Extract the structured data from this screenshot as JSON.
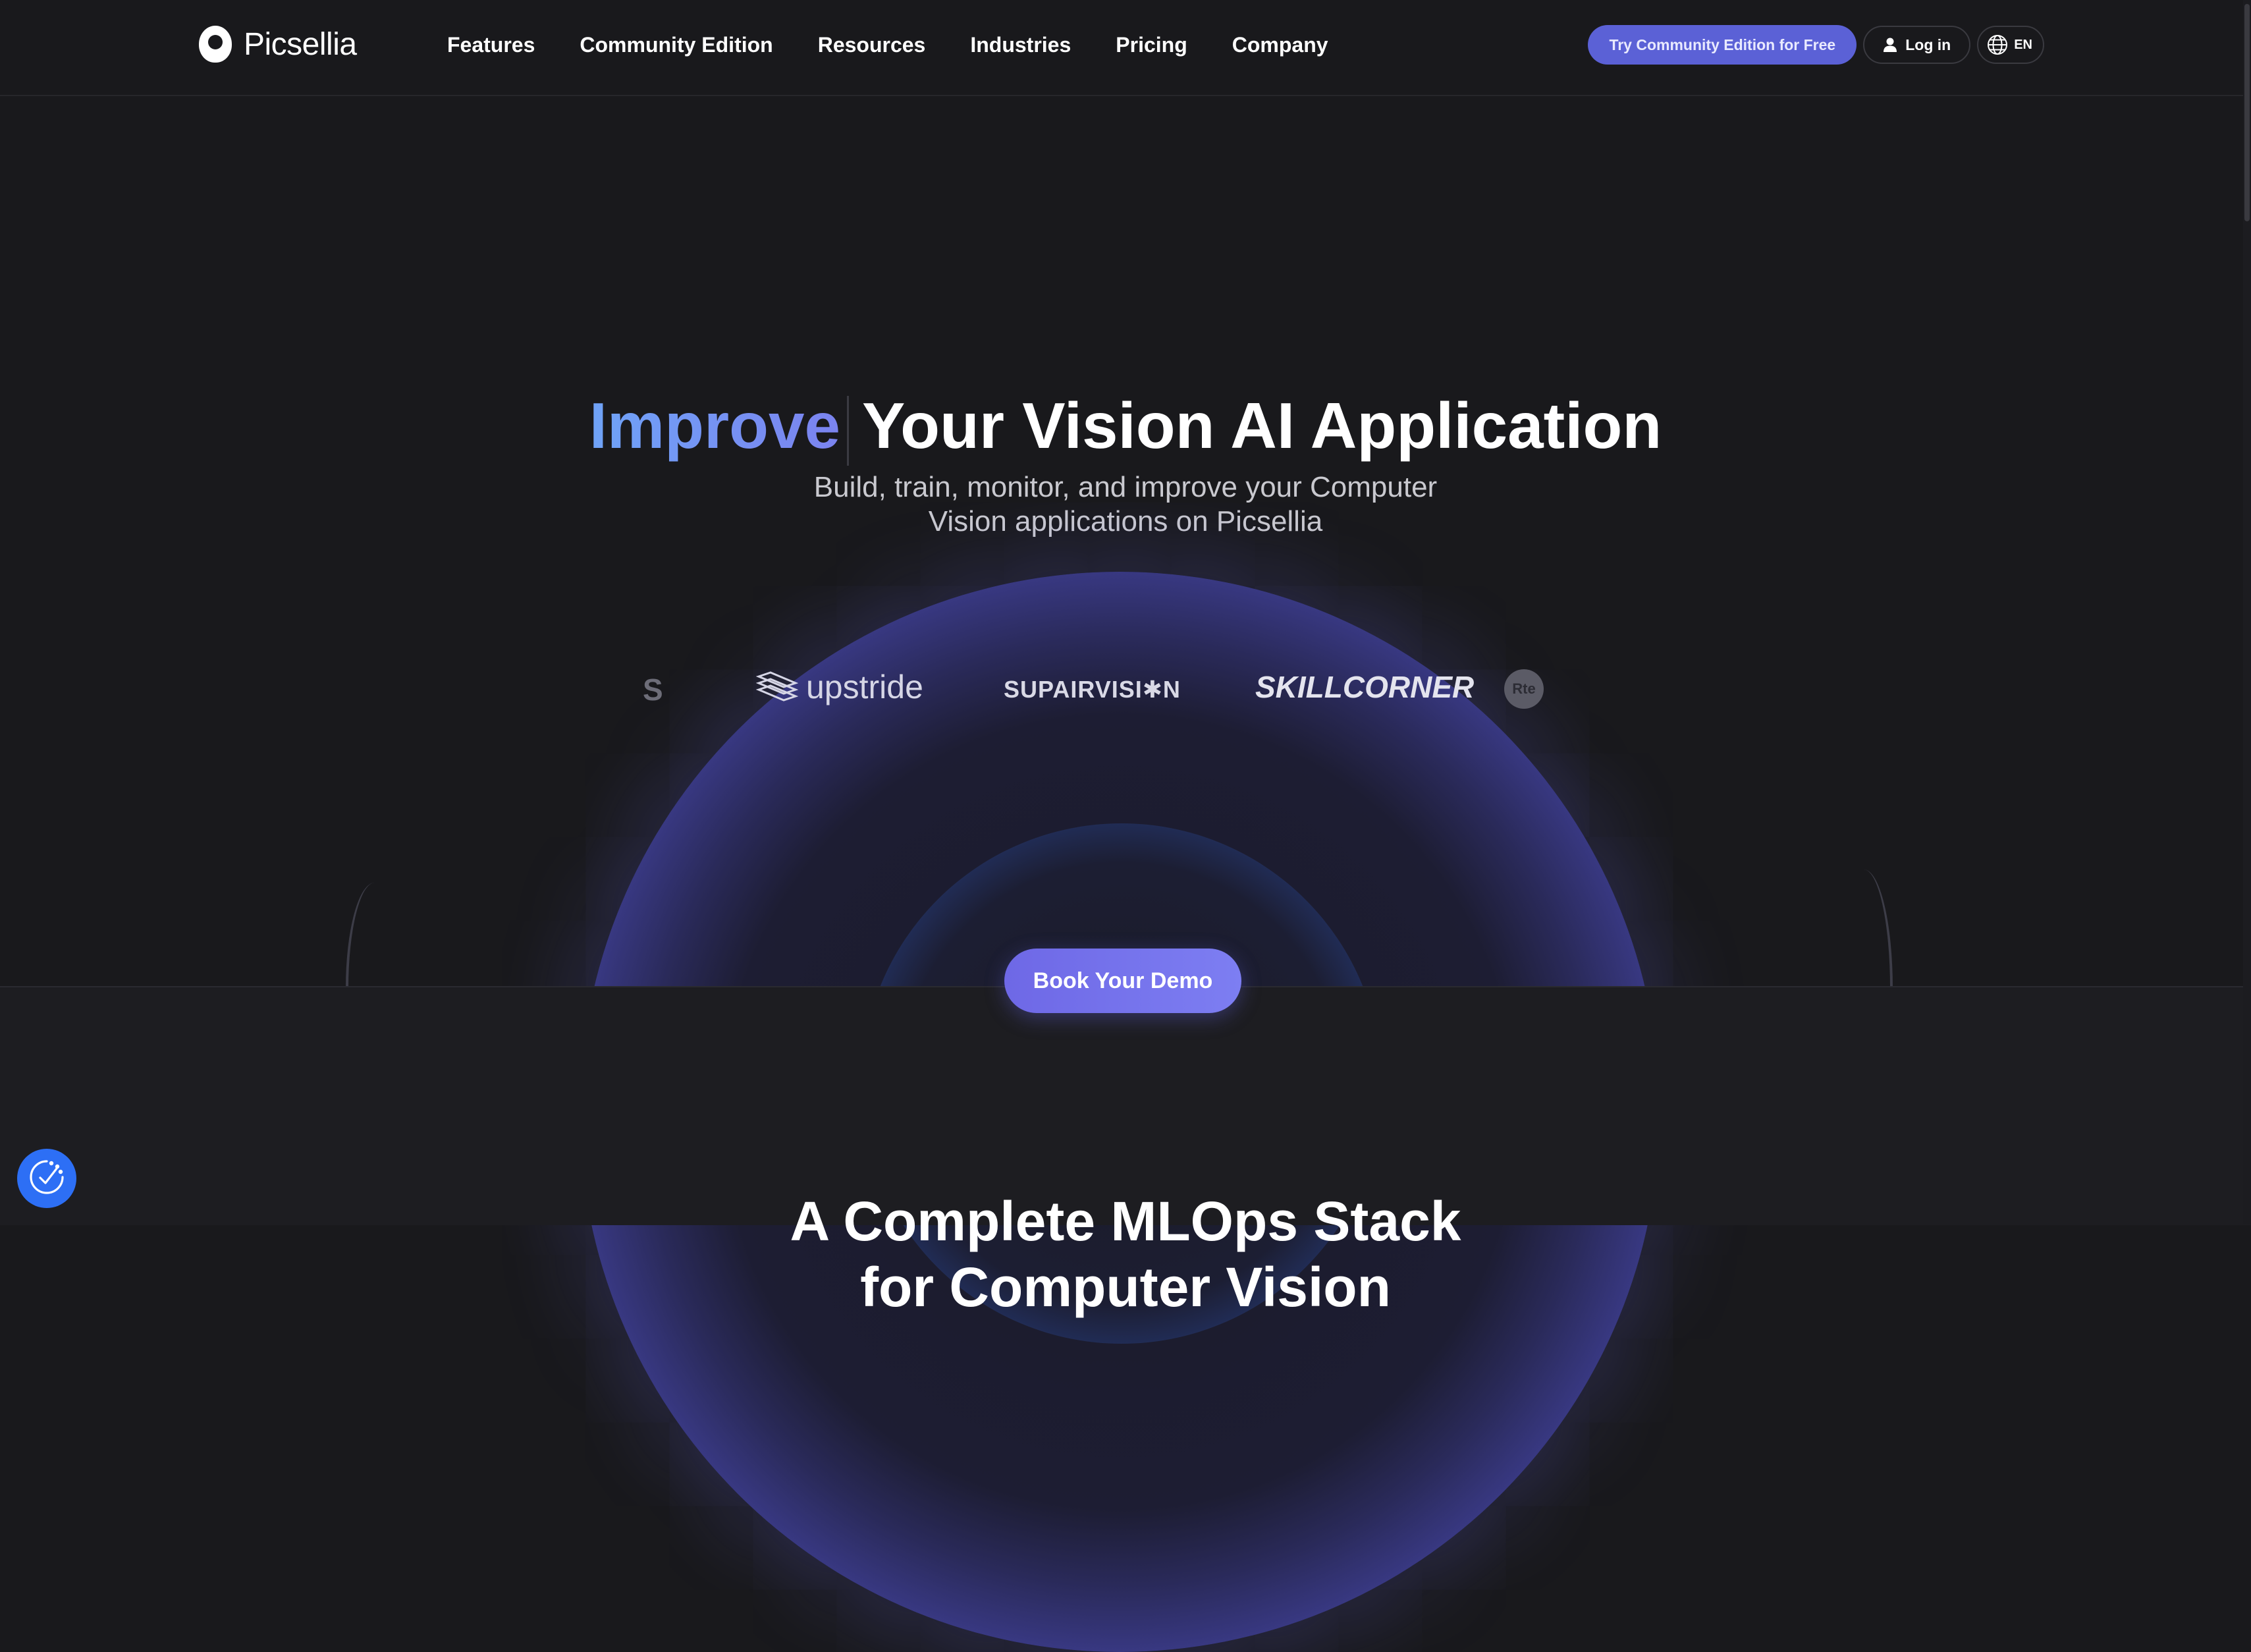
{
  "brand": {
    "name": "Picsellia"
  },
  "nav": {
    "links": [
      "Features",
      "Community Edition",
      "Resources",
      "Industries",
      "Pricing",
      "Company"
    ],
    "try_button": "Try Community Edition for Free",
    "login_button": "Log in",
    "language": "EN"
  },
  "hero": {
    "title_accent": "Improve",
    "title_rest": "Your Vision AI Application",
    "subtitle": "Build, train, monitor, and improve your Computer Vision applications on Picsellia",
    "cta": "Book Your Demo"
  },
  "clients": {
    "partial": "S",
    "upstride": "upstride",
    "supairvision": "SUPAIRVISI✱N",
    "skillcorner": "SKILLCORNER",
    "rte": "Rte"
  },
  "section": {
    "title_line1": "A Complete MLOps Stack",
    "title_line2": "for Computer Vision"
  },
  "colors": {
    "background": "#19191c",
    "accent": "#5b61d6",
    "accent_gradient_start": "#6fa3f7",
    "accent_gradient_end": "#7b83ef",
    "badge": "#2d6ff5"
  },
  "icons": {
    "logo": "picsellia-logo-icon",
    "user": "user-icon",
    "globe": "globe-icon",
    "consent": "cookie-consent-icon"
  }
}
